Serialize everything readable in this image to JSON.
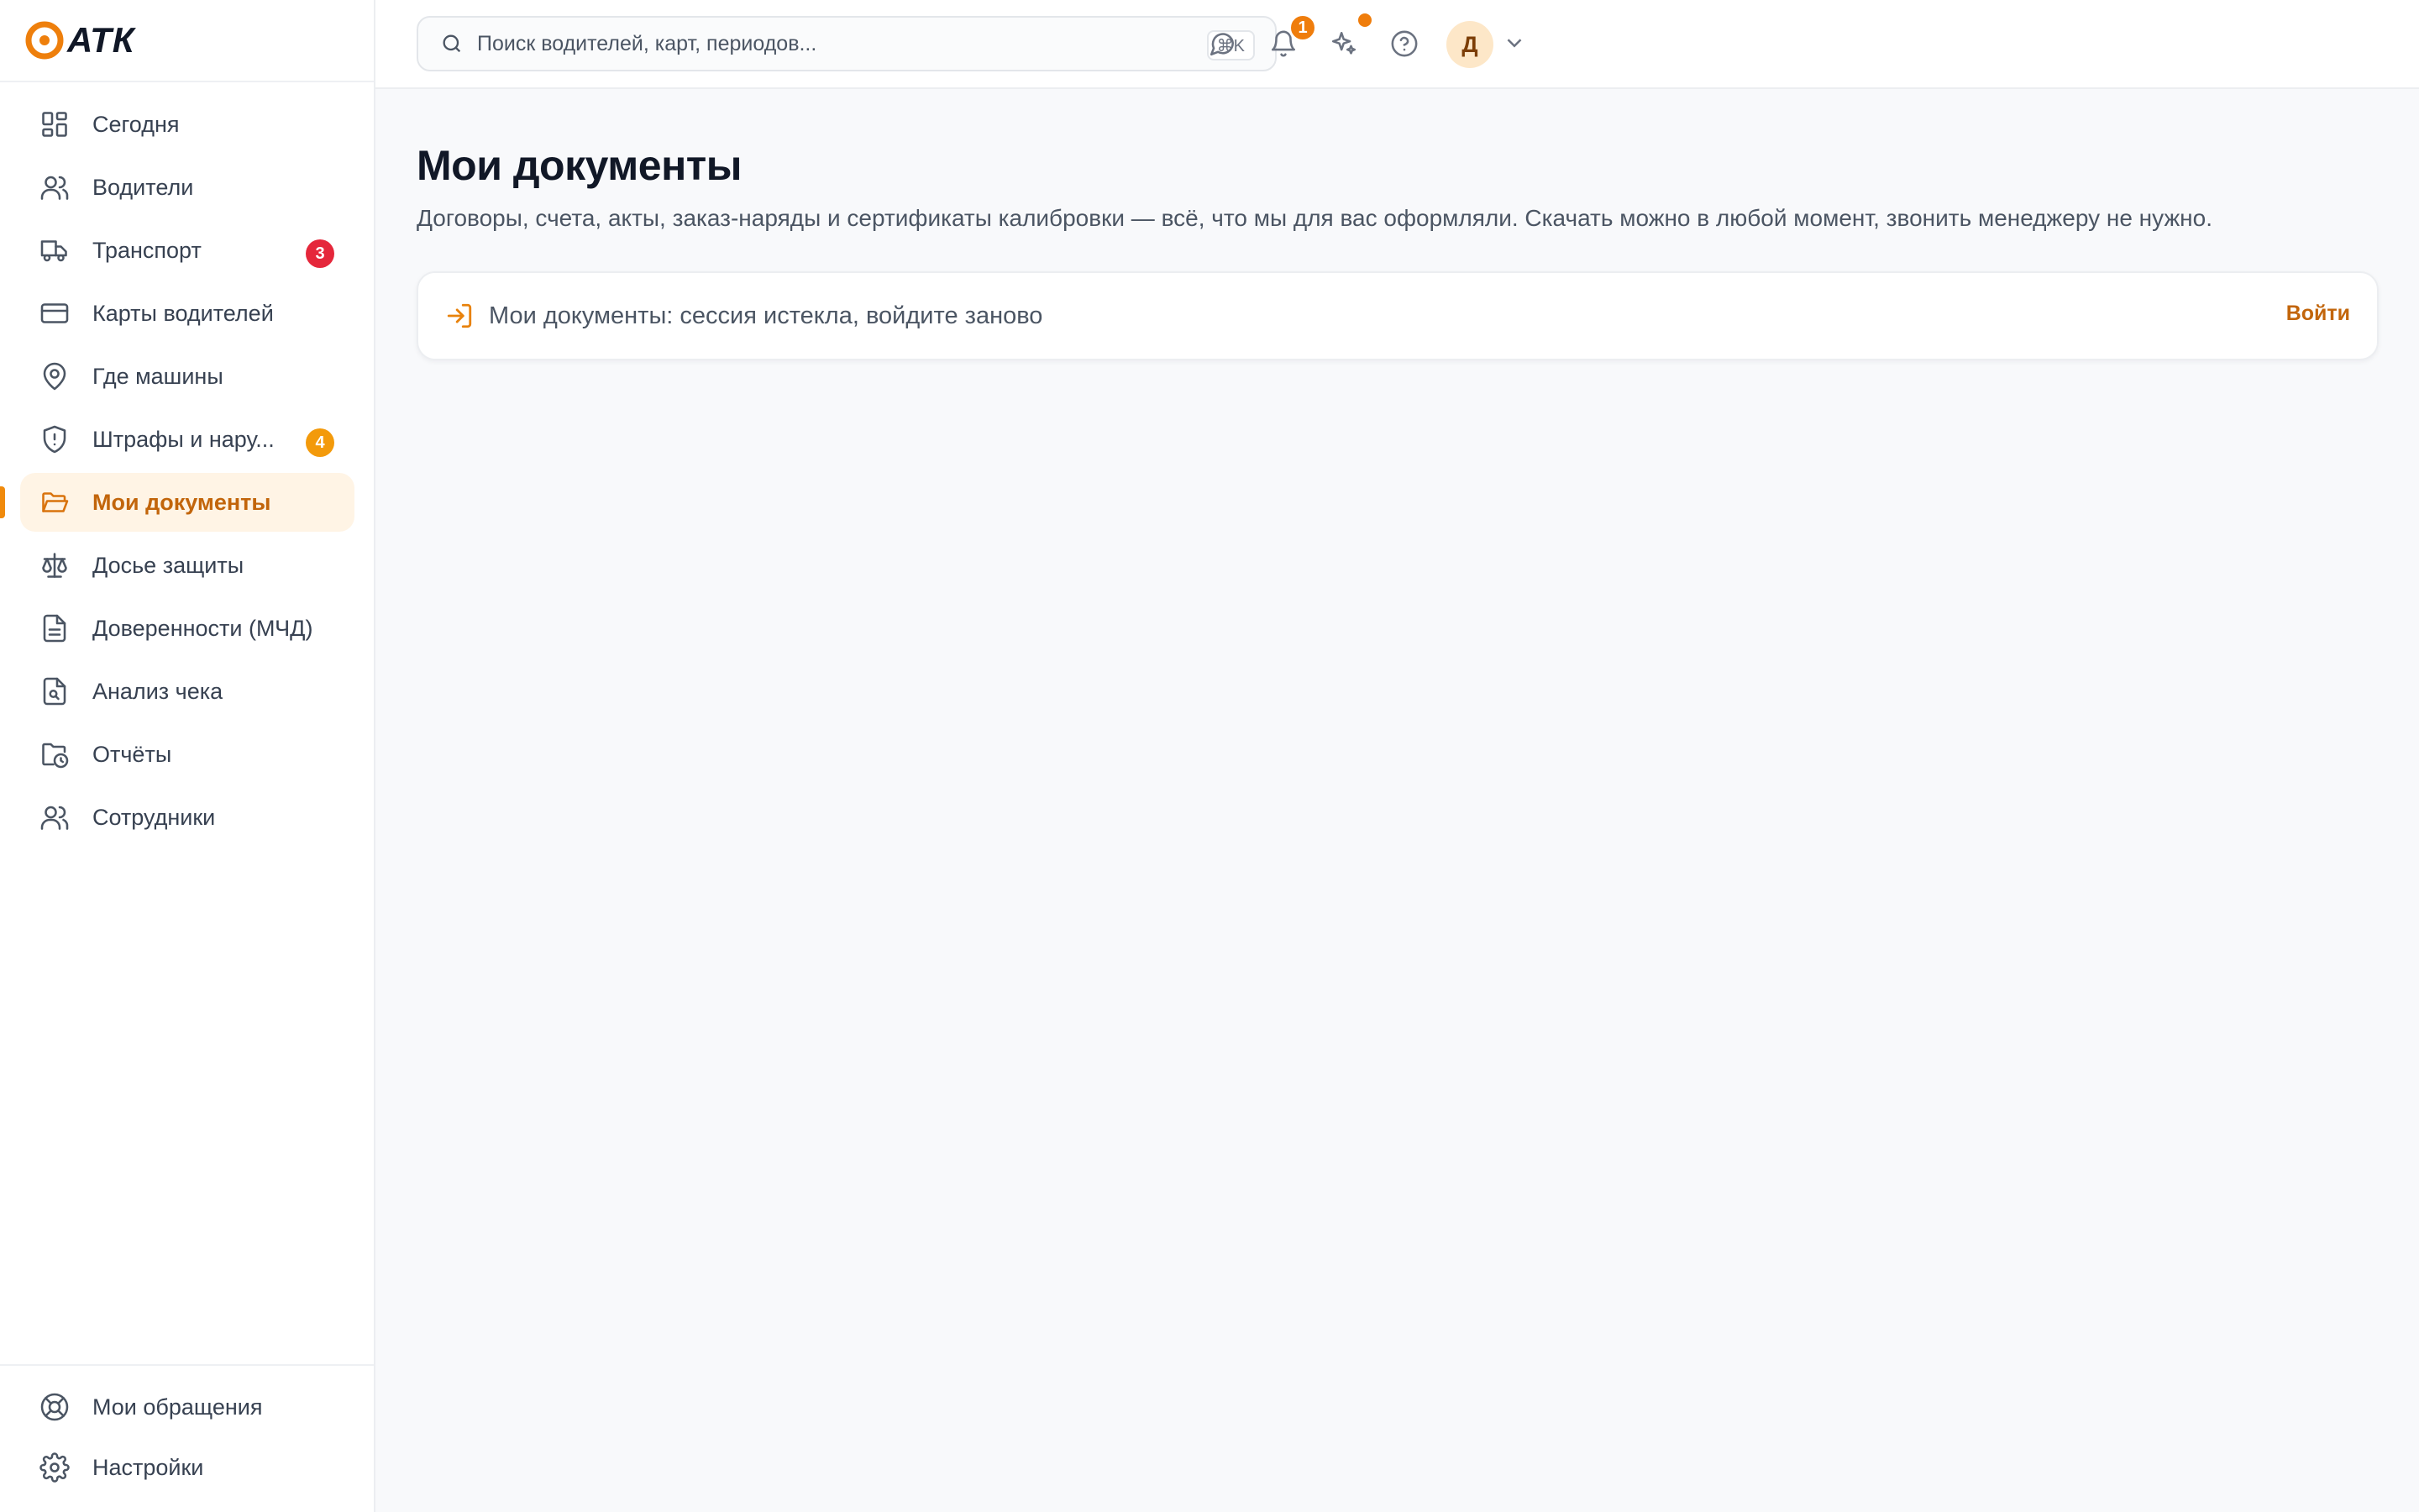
{
  "brand": {
    "name": "АТК",
    "logo_icon": "atk-logo-icon",
    "accent": "#f08a0c"
  },
  "sidebar": {
    "items": [
      {
        "label": "Сегодня",
        "icon": "dashboard-grid-icon"
      },
      {
        "label": "Водители",
        "icon": "users-icon"
      },
      {
        "label": "Транспорт",
        "icon": "truck-icon",
        "badge": "3",
        "badge_color": "#e5273b"
      },
      {
        "label": "Карты водителей",
        "icon": "card-icon"
      },
      {
        "label": "Где машины",
        "icon": "map-pin-icon"
      },
      {
        "label": "Штрафы и нару...",
        "icon": "shield-alert-icon",
        "badge": "4",
        "badge_color": "#f39a0b"
      },
      {
        "label": "Мои документы",
        "icon": "folder-open-icon",
        "active": true
      },
      {
        "label": "Досье защиты",
        "icon": "scales-icon"
      },
      {
        "label": "Доверенности (МЧД)",
        "icon": "document-icon"
      },
      {
        "label": "Анализ чека",
        "icon": "file-search-icon"
      },
      {
        "label": "Отчёты",
        "icon": "folder-clock-icon"
      },
      {
        "label": "Сотрудники",
        "icon": "team-icon"
      }
    ],
    "bottom_items": [
      {
        "label": "Мои обращения",
        "icon": "lifebuoy-icon"
      },
      {
        "label": "Настройки",
        "icon": "gear-icon"
      }
    ]
  },
  "header": {
    "search_placeholder": "Поиск водителей, карт, периодов...",
    "search_shortcut": "⌘K",
    "notifications_count": "1",
    "avatar_initial": "Д"
  },
  "main": {
    "title": "Мои документы",
    "subtitle": "Договоры, счета, акты, заказ-наряды и сертификаты калибровки — всё, что мы для вас оформляли. Скачать можно в любой момент, звонить менеджеру не нужно.",
    "alert_text": "Мои документы: сессия истекла, войдите заново",
    "alert_action": "Войти"
  }
}
